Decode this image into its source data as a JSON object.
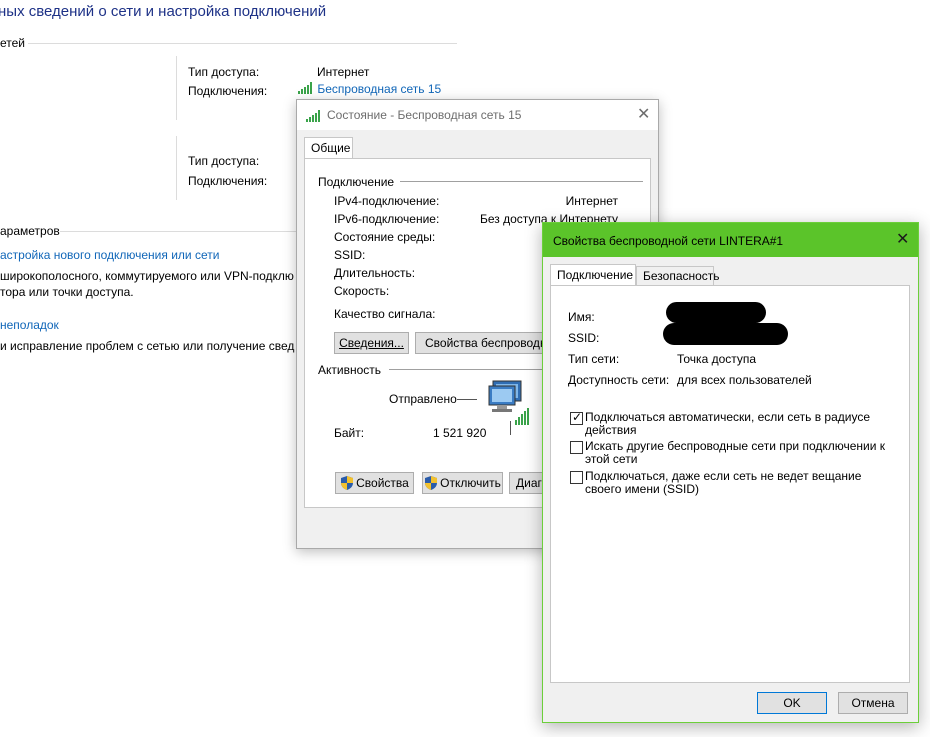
{
  "background": {
    "title": "ных сведений о сети и настройка подключений",
    "section_networks": "етей",
    "net1": {
      "access_type_label": "Тип доступа:",
      "access_type_value": "Интернет",
      "connections_label": "Подключения:",
      "connections_value": "Беспроводная сеть 15"
    },
    "net2": {
      "access_type_label": "Тип доступа:",
      "connections_label": "Подключения:"
    },
    "section_params": "араметров",
    "link_new_connection": "астройка нового подключения или сети",
    "desc_new_connection_1": "широкополосного, коммутируемого или VPN-подклю",
    "desc_new_connection_2": "тора или точки доступа.",
    "link_troubleshoot": "неполадок",
    "desc_troubleshoot": "и исправление проблем с сетью или получение свед"
  },
  "status_dialog": {
    "title": "Состояние - Беспроводная сеть 15",
    "tab_general": "Общие",
    "section_connection": "Подключение",
    "rows": [
      {
        "label": "IPv4-подключение:",
        "value": "Интернет"
      },
      {
        "label": "IPv6-подключение:",
        "value": "Без доступа к Интернету"
      },
      {
        "label": "Состояние среды:",
        "value": ""
      },
      {
        "label": "SSID:",
        "value": ""
      },
      {
        "label": "Длительность:",
        "value": ""
      },
      {
        "label": "Скорость:",
        "value": ""
      }
    ],
    "signal_label": "Качество сигнала:",
    "details_button": "Сведения...",
    "wireless_props_button": "Свойства беспроводной",
    "section_activity": "Активность",
    "sent_label": "Отправлено",
    "bytes_label": "Байт:",
    "bytes_sent": "1 521 920",
    "properties_button": "Свойства",
    "disconnect_button": "Отключить",
    "diagnose_button": "Диаг"
  },
  "properties_dialog": {
    "title": "Свойства беспроводной сети LINTERA#1",
    "tab_connection": "Подключение",
    "tab_security": "Безопасность",
    "name_label": "Имя:",
    "ssid_label": "SSID:",
    "network_type_label": "Тип сети:",
    "network_type_value": "Точка доступа",
    "availability_label": "Доступность сети:",
    "availability_value": "для всех пользователей",
    "opt_auto_1": "Подключаться автоматически, если сеть в радиусе",
    "opt_auto_2": "действия",
    "opt_auto_checked": true,
    "opt_search_1": "Искать другие беспроводные сети при подключении к",
    "opt_search_2": "этой сети",
    "opt_search_checked": false,
    "opt_hidden_1": "Подключаться, даже если сеть не ведет вещание",
    "opt_hidden_2": "своего имени (SSID)",
    "opt_hidden_checked": false,
    "ok_button": "OK",
    "cancel_button": "Отмена"
  },
  "colors": {
    "accent_green": "#5bc42a",
    "link_blue": "#1066b8",
    "title_blue": "#1e3287"
  },
  "icons": [
    "signal-bars-icon",
    "close-icon",
    "computer-network-icon",
    "shield-icon",
    "check-icon"
  ]
}
